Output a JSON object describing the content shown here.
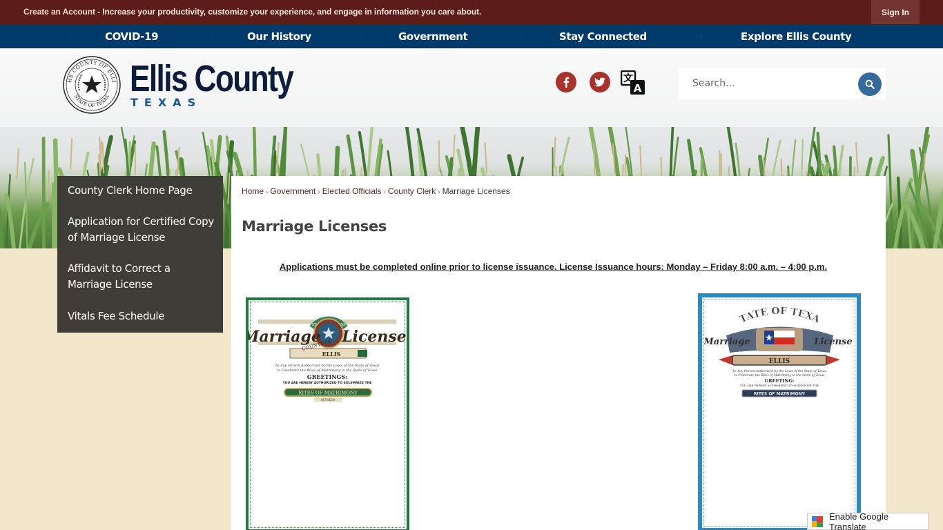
{
  "topbar": {
    "create_account_lead": "Create an Account",
    "create_account_text": " - Increase your productivity, customize your experience, and engage in information you care about.",
    "sign_in_label": "Sign In"
  },
  "nav": {
    "items": [
      {
        "label": "COVID-19"
      },
      {
        "label": "Our History"
      },
      {
        "label": "Government"
      },
      {
        "label": "Stay Connected"
      },
      {
        "label": "Explore Ellis County"
      }
    ],
    "arrow_glyph": "↓"
  },
  "header": {
    "seal_top_text": "THE COUNTY OF ELLIS",
    "seal_bottom_text": "STATE OF TEXAS",
    "logo_title": "Ellis County",
    "logo_subtitle": "TEXAS",
    "social": [
      {
        "name": "facebook",
        "glyph": "f"
      },
      {
        "name": "twitter",
        "glyph": "t"
      }
    ],
    "search": {
      "placeholder": "Search...",
      "value": ""
    }
  },
  "sidebar": {
    "items": [
      {
        "label": "County Clerk Home Page"
      },
      {
        "label": "Application for Certified Copy of Marriage License"
      },
      {
        "label": "Affidavit to Correct a Marriage License"
      },
      {
        "label": "Vitals Fee Schedule"
      }
    ]
  },
  "breadcrumb": {
    "items": [
      "Home",
      "Government",
      "Elected Officials",
      "County Clerk"
    ],
    "current": "Marriage Licenses",
    "separator": "›"
  },
  "page": {
    "title": "Marriage Licenses",
    "notice": "Applications must be completed online prior to license issuance.  License Issuance hours: Monday – Friday 8:00 a.m. – 4:00 p.m."
  },
  "certificates": {
    "green": {
      "arc_text": "STATE OF TEXAS",
      "word_left": "Marriage",
      "word_right": "License",
      "county_label": "COUNTY OF",
      "county_name": "ELLIS",
      "line1": "To Any Person Authorized by the Laws of the State of Texas",
      "line2": "to Celebrate the Rites of Matrimony in the State of Texas",
      "greeting": "GREETINGS:",
      "authorized": "YOU ARE HEREBY AUTHORIZED TO SOLEMNIZE THE",
      "rites": "RITES OF MATRIMONY",
      "between": "BETWEEN"
    },
    "blue": {
      "arc_text": "STATE OF TEXAS",
      "word_left": "Marriage",
      "word_right": "License",
      "county_name": "ELLIS",
      "line1": "To Any Person Authorized by the Laws of the State of Texas",
      "line2": "to Celebrate the Rites of Matrimony in the State of Texas",
      "greeting": "GREETING:",
      "authorized": "YOU ARE HEREBY AUTHORIZED TO SOLEMNIZE THE",
      "rites": "RITES OF MATRIMONY"
    }
  },
  "google_translate": {
    "label": "Enable Google Translate"
  },
  "colors": {
    "topbar": "#5c1c1a",
    "nav": "#003a6a",
    "sidebar": "#403c37",
    "social": "#a8322c",
    "search_button": "#34699b",
    "page_background": "#f2e6cb"
  }
}
